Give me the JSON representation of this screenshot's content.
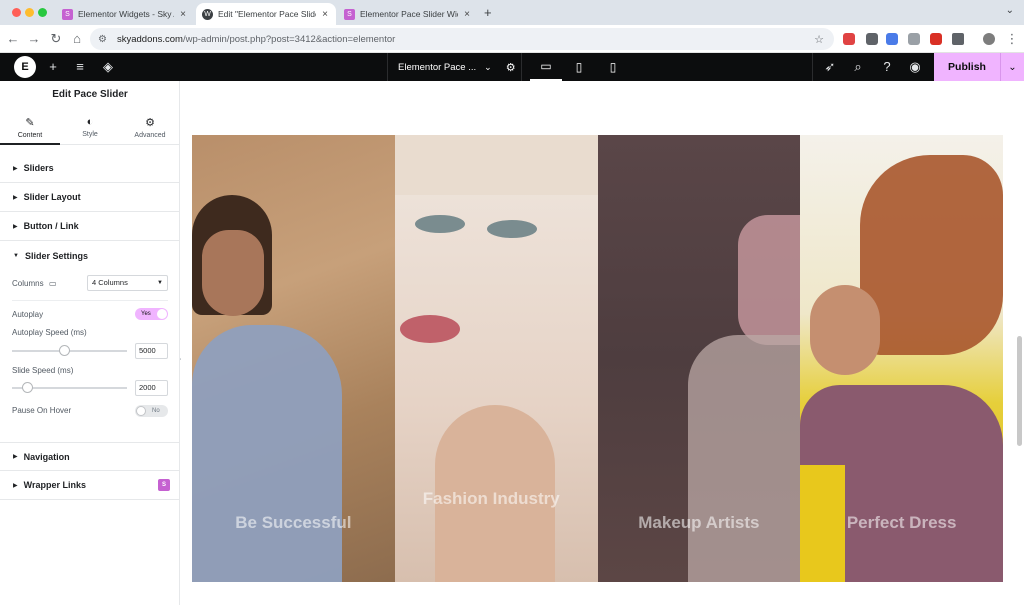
{
  "browser": {
    "tabs": [
      {
        "title": "Elementor Widgets - Sky Addons",
        "favicon": "sky-addons-icon"
      },
      {
        "title": "Edit \"Elementor Pace Slider W",
        "favicon": "wordpress-icon"
      },
      {
        "title": "Elementor Pace Slider Widget",
        "favicon": "sky-addons-icon"
      }
    ],
    "active_tab": 1,
    "url_host": "skyaddons.com",
    "url_path": "/wp-admin/post.php?post=3412&action=elementor"
  },
  "topbar": {
    "document_title": "Elementor Pace ...",
    "publish_label": "Publish",
    "accent": "#f0b4ff"
  },
  "panel": {
    "title": "Edit Pace Slider",
    "tabs": [
      {
        "label": "Content",
        "icon": "pencil-icon"
      },
      {
        "label": "Style",
        "icon": "half-circle-icon"
      },
      {
        "label": "Advanced",
        "icon": "gear-icon"
      }
    ],
    "sections": {
      "sliders": "Sliders",
      "slider_layout": "Slider Layout",
      "button_link": "Button / Link",
      "slider_settings": "Slider Settings",
      "navigation": "Navigation",
      "wrapper_links": "Wrapper Links"
    },
    "settings": {
      "columns_label": "Columns",
      "columns_value": "4 Columns",
      "autoplay_label": "Autoplay",
      "autoplay_value": "Yes",
      "autoplay_speed_label": "Autoplay Speed (ms)",
      "autoplay_speed_value": "5000",
      "autoplay_speed_level": 0.45,
      "slide_speed_label": "Slide Speed (ms)",
      "slide_speed_value": "2000",
      "slide_speed_level": 0.1,
      "pause_label": "Pause On Hover",
      "pause_value": "No"
    }
  },
  "slides": [
    {
      "caption": "Be Successful"
    },
    {
      "caption": "Fashion Industry"
    },
    {
      "caption": "Makeup Artists"
    },
    {
      "caption": "Perfect Dress"
    }
  ]
}
